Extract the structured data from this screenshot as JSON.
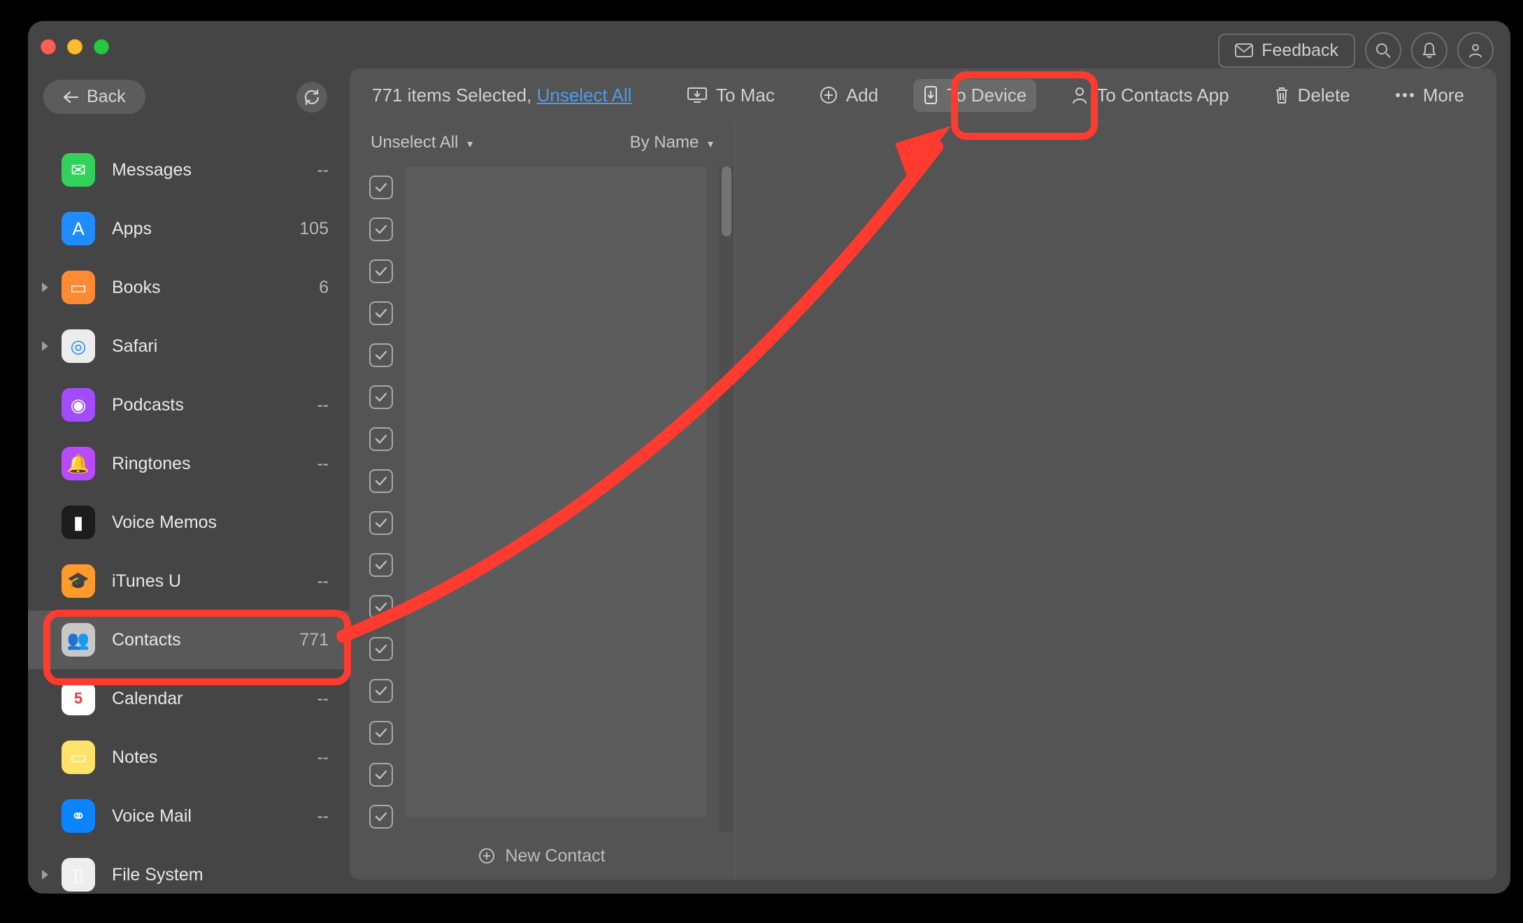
{
  "titlebar": {
    "feedback_label": "Feedback"
  },
  "back_label": "Back",
  "sidebar": {
    "items": [
      {
        "label": "Messages",
        "count": "--",
        "chev": false,
        "icon_bg": "#33d15b",
        "icon_glyph": "✉︎"
      },
      {
        "label": "Apps",
        "count": "105",
        "chev": false,
        "icon_bg": "#1f8cff",
        "icon_glyph": "A"
      },
      {
        "label": "Books",
        "count": "6",
        "chev": true,
        "icon_bg": "#ff8a34",
        "icon_glyph": "▭"
      },
      {
        "label": "Safari",
        "count": "",
        "chev": true,
        "icon_bg": "#ececec",
        "icon_glyph": "◎"
      },
      {
        "label": "Podcasts",
        "count": "--",
        "chev": false,
        "icon_bg": "#a24bff",
        "icon_glyph": "◉"
      },
      {
        "label": "Ringtones",
        "count": "--",
        "chev": false,
        "icon_bg": "#b94bff",
        "icon_glyph": "🔔"
      },
      {
        "label": "Voice Memos",
        "count": "",
        "chev": false,
        "icon_bg": "#1c1c1c",
        "icon_glyph": "▮"
      },
      {
        "label": "iTunes U",
        "count": "--",
        "chev": false,
        "icon_bg": "#ff9a2b",
        "icon_glyph": "🎓"
      },
      {
        "label": "Contacts",
        "count": "771",
        "chev": false,
        "icon_bg": "#c8c8c8",
        "icon_glyph": "👥",
        "selected": true
      },
      {
        "label": "Calendar",
        "count": "--",
        "chev": false,
        "icon_bg": "#ffffff",
        "icon_glyph": "5"
      },
      {
        "label": "Notes",
        "count": "--",
        "chev": false,
        "icon_bg": "#ffe26a",
        "icon_glyph": "▭"
      },
      {
        "label": "Voice Mail",
        "count": "--",
        "chev": false,
        "icon_bg": "#0a84ff",
        "icon_glyph": "⚭"
      },
      {
        "label": "File System",
        "count": "",
        "chev": true,
        "icon_bg": "#eeeeee",
        "icon_glyph": "▯"
      }
    ]
  },
  "toolbar": {
    "selected_text": "771 items Selected, ",
    "unselect_link": "Unselect All",
    "to_mac": "To Mac",
    "add": "Add",
    "to_device": "To Device",
    "to_contacts_app": "To Contacts App",
    "delete": "Delete",
    "more": "More"
  },
  "list": {
    "unselect_dropdown": "Unselect All",
    "sort_dropdown": "By Name",
    "new_contact": "New Contact",
    "row_count": 16
  }
}
